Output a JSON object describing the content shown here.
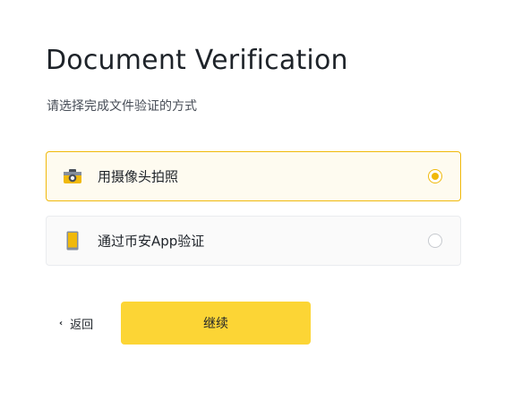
{
  "header": {
    "title": "Document Verification",
    "subtitle": "请选择完成文件验证的方式"
  },
  "options": [
    {
      "label": "用摄像头拍照",
      "icon": "camera-icon",
      "selected": true
    },
    {
      "label": "通过币安App验证",
      "icon": "phone-icon",
      "selected": false
    }
  ],
  "footer": {
    "back_label": "返回",
    "back_icon": "chevron-left-icon",
    "continue_label": "继续"
  },
  "colors": {
    "accent": "#f0b90b",
    "button": "#fcd535",
    "text": "#1e2329"
  }
}
